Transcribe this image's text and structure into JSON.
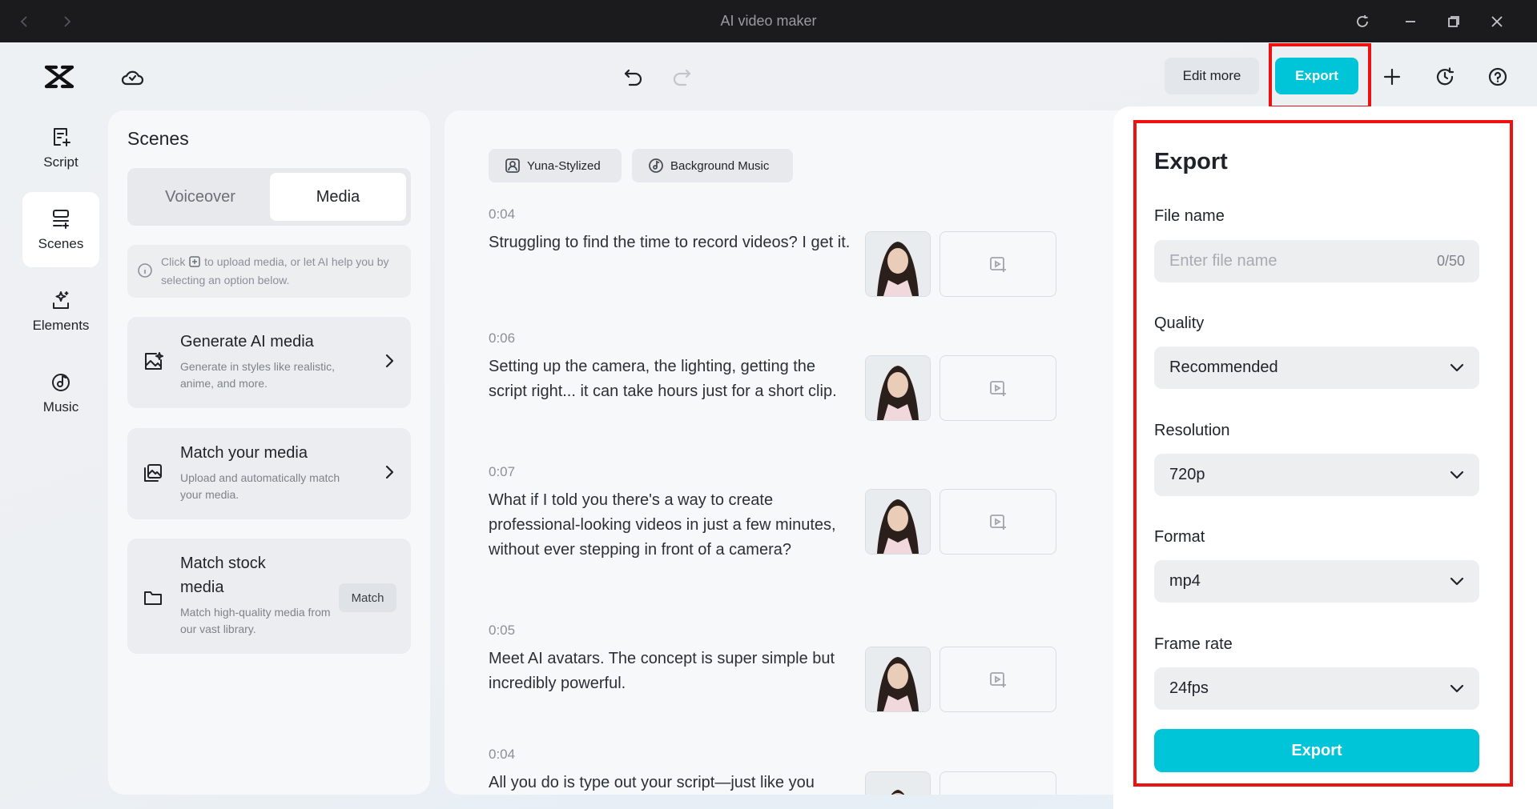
{
  "window": {
    "title": "AI video maker"
  },
  "toolbar": {
    "edit_more": "Edit more",
    "export": "Export"
  },
  "rail": [
    {
      "label": "Script",
      "icon": "script-icon"
    },
    {
      "label": "Scenes",
      "icon": "scenes-icon",
      "active": true
    },
    {
      "label": "Elements",
      "icon": "elements-icon"
    },
    {
      "label": "Music",
      "icon": "music-icon"
    }
  ],
  "scenes_panel": {
    "title": "Scenes",
    "tabs": {
      "voiceover": "Voiceover",
      "media": "Media",
      "selected": "Media"
    },
    "info_before": "Click",
    "info_after": "to upload media, or let AI help you by selecting an option below.",
    "cards": [
      {
        "title": "Generate AI media",
        "desc": "Generate in styles like realistic, anime, and more."
      },
      {
        "title": "Match your media",
        "desc": "Upload and automatically match your media."
      },
      {
        "title_line1": "Match stock",
        "title_line2": "media",
        "desc": "Match high-quality media from our vast library.",
        "button": "Match"
      }
    ]
  },
  "script": {
    "chips": {
      "avatar": "Yuna-Stylized",
      "music": "Background Music"
    },
    "scenes": [
      {
        "time": "0:04",
        "text": "Struggling to find the time to record videos? I get it."
      },
      {
        "time": "0:06",
        "text": "Setting up the camera, the lighting, getting the script right... it can take hours just for a short clip."
      },
      {
        "time": "0:07",
        "text": "What if I told you there's a way to create professional-looking videos in just a few minutes, without ever stepping in front of a camera?"
      },
      {
        "time": "0:05",
        "text": "Meet AI avatars. The concept is super simple but incredibly powerful."
      },
      {
        "time": "0:04",
        "text": "All you do is type out your script—just like you"
      }
    ]
  },
  "export_panel": {
    "title": "Export",
    "file_name_label": "File name",
    "file_name_placeholder": "Enter file name",
    "file_name_count": "0/50",
    "quality_label": "Quality",
    "quality_value": "Recommended",
    "resolution_label": "Resolution",
    "resolution_value": "720p",
    "format_label": "Format",
    "format_value": "mp4",
    "frame_rate_label": "Frame rate",
    "frame_rate_value": "24fps",
    "export_button": "Export"
  },
  "colors": {
    "accent": "#00c4d8",
    "highlight": "#ee1111"
  }
}
